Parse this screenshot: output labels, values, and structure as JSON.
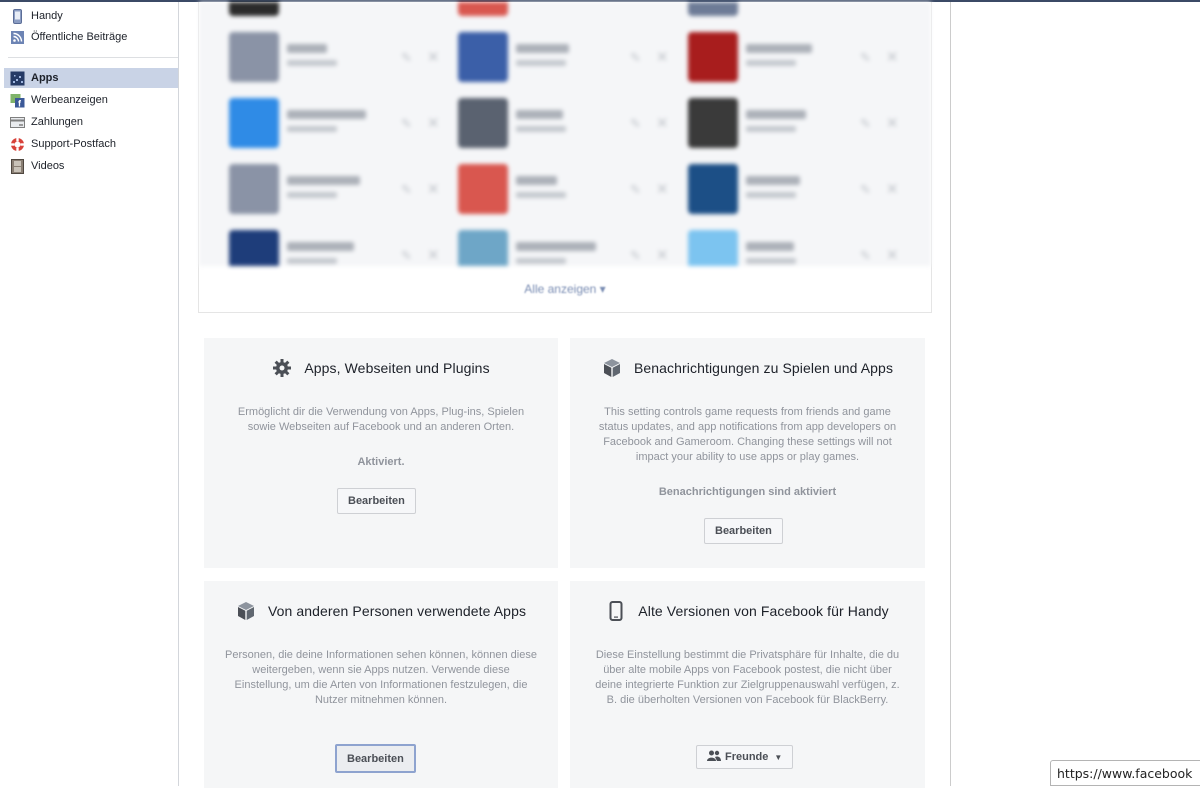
{
  "sidebar": {
    "items": [
      {
        "label": "Handy",
        "icon": "mobile-phone-icon",
        "active": false
      },
      {
        "label": "Öffentliche Beiträge",
        "icon": "rss-feed-icon",
        "active": false
      },
      {
        "label": "Apps",
        "icon": "apps-icon",
        "active": true
      },
      {
        "label": "Werbeanzeigen",
        "icon": "ads-icon",
        "active": false
      },
      {
        "label": "Zahlungen",
        "icon": "credit-card-icon",
        "active": false
      },
      {
        "label": "Support-Postfach",
        "icon": "lifebuoy-icon",
        "active": false
      },
      {
        "label": "Videos",
        "icon": "film-icon",
        "active": false
      }
    ]
  },
  "apps_list": {
    "apps_blurred": true,
    "show_all_label": "Alle anzeigen ▾",
    "app_icon_colors": [
      [
        "#8a93a6",
        "#3b5fa8",
        "#a81d1d"
      ],
      [
        "#2f8be6",
        "#5a6270",
        "#3a3a3a"
      ],
      [
        "#8a93a6",
        "#d9574f",
        "#1c4f86"
      ],
      [
        "#1e3d7a",
        "#6ea6c7",
        "#7cc4f0"
      ]
    ],
    "edit_icon": "pencil-icon",
    "remove_icon": "close-icon"
  },
  "cards": {
    "apps_websites_plugins": {
      "icon": "gear-icon",
      "title": "Apps, Webseiten und Plugins",
      "description": "Ermöglicht dir die Verwendung von Apps, Plug-ins, Spielen sowie Webseiten auf Facebook und an anderen Orten.",
      "status": "Aktiviert.",
      "button": "Bearbeiten"
    },
    "game_app_notifications": {
      "icon": "cube-icon",
      "title": "Benachrichtigungen zu Spielen und Apps",
      "description": "This setting controls game requests from friends and game status updates, and app notifications from app developers on Facebook and Gameroom. Changing these settings will not impact your ability to use apps or play games.",
      "status": "Benachrichtigungen sind aktiviert",
      "button": "Bearbeiten"
    },
    "apps_others_use": {
      "icon": "cube-icon",
      "title": "Von anderen Personen verwendete Apps",
      "description": "Personen, die deine Informationen sehen können, können diese weitergeben, wenn sie Apps nutzen. Verwende diese Einstellung, um die Arten von Informationen festzulegen, die Nutzer mitnehmen können.",
      "button": "Bearbeiten"
    },
    "old_mobile_versions": {
      "icon": "mobile-phone-icon",
      "title": "Alte Versionen von Facebook für Handy",
      "description": "Diese Einstellung bestimmt die Privatsphäre für Inhalte, die du über alte mobile Apps von Facebook postest, die nicht über deine integrierte Funktion zur Zielgruppenauswahl verfügen, z. B. die überholten Versionen von Facebook für BlackBerry.",
      "audience_selector": "Freunde"
    }
  },
  "status_bar": {
    "url": "https://www.facebook"
  }
}
